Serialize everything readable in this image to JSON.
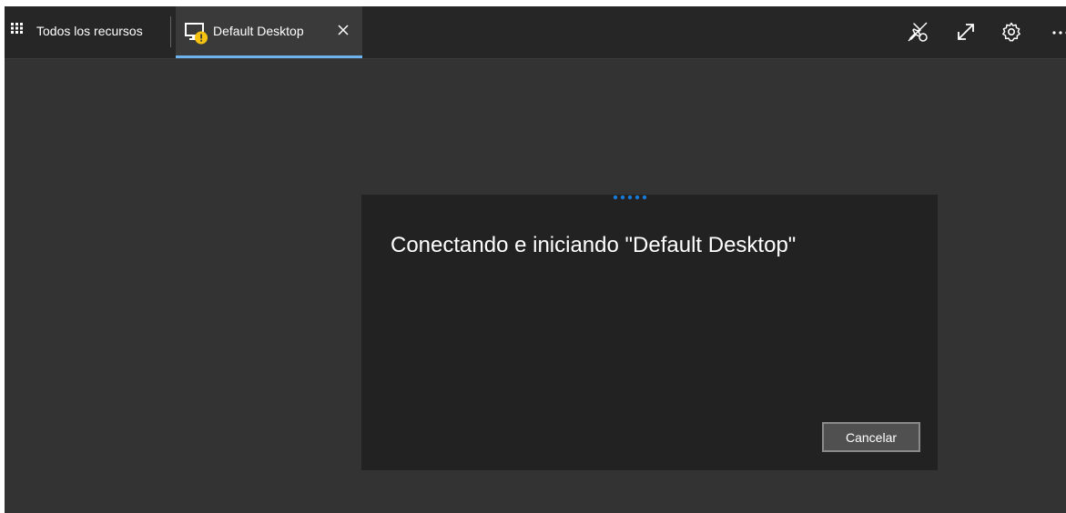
{
  "topbar": {
    "all_resources_label": "Todos los recursos",
    "tab_label": "Default Desktop",
    "tab_icon": "desktop-warning-icon",
    "tools": [
      "unpin-icon",
      "expand-icon",
      "gear-icon",
      "more-icon"
    ]
  },
  "dialog": {
    "title": "Conectando e iniciando \"Default Desktop\"",
    "cancel_label": "Cancelar"
  },
  "colors": {
    "topbar_bg": "#262626",
    "content_bg": "#333333",
    "dialog_bg": "#222222",
    "accent": "#6cb3f0",
    "progress": "#1a7bd4",
    "warning": "#f5c211"
  }
}
